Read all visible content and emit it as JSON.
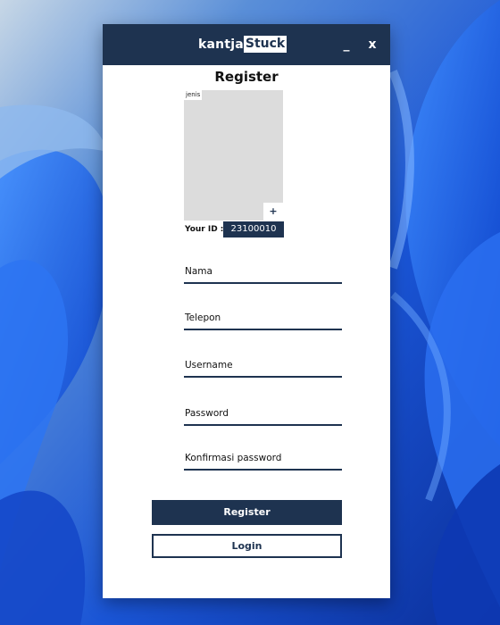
{
  "app": {
    "logo_part1": "kantja",
    "logo_part2": "Stuck",
    "minimize_label": "_",
    "close_label": "x"
  },
  "form": {
    "title": "Register",
    "photo_tag": "jenis",
    "photo_add_label": "+",
    "id_label": "Your ID :",
    "id_value": "23100010",
    "fields": [
      {
        "label": "Nama"
      },
      {
        "label": "Telepon"
      },
      {
        "label": "Username"
      },
      {
        "label": "Password"
      },
      {
        "label": "Konfirmasi password"
      }
    ],
    "register_label": "Register",
    "login_label": "Login"
  },
  "colors": {
    "primary": "#1e3350",
    "window_bg": "#ffffff",
    "photo_bg": "#dcdcdc",
    "desktop_blue": "#1f5fe0"
  }
}
